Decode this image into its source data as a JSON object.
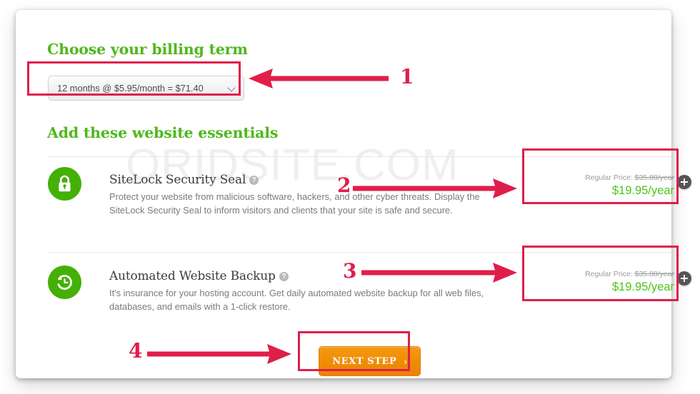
{
  "watermark": "ORIDSITE.COM",
  "billing": {
    "heading": "Choose your billing term",
    "selected_option": "12 months @ $5.95/month = $71.40",
    "chevron_icon": "chevron-down-icon"
  },
  "essentials": {
    "heading": "Add these website essentials",
    "items": [
      {
        "icon": "padlock-icon",
        "title": "SiteLock Security Seal",
        "help_icon": "question-mark-icon",
        "help_glyph": "?",
        "description": "Protect your website from malicious software, hackers, and other cyber threats. Display the SiteLock Security Seal to inform visitors and clients that your site is safe and secure.",
        "regular_price_label": "Regular Price:",
        "regular_price": "$35.88/year",
        "sale_price": "$19.95/year",
        "add_icon": "plus-icon"
      },
      {
        "icon": "clock-restore-icon",
        "title": "Automated Website Backup",
        "help_icon": "question-mark-icon",
        "help_glyph": "?",
        "description": "It's insurance for your hosting account. Get daily automated website backup for all web files, databases, and emails with a 1-click restore.",
        "regular_price_label": "Regular Price:",
        "regular_price": "$35.88/year",
        "sale_price": "$19.95/year",
        "add_icon": "plus-icon"
      }
    ]
  },
  "next_button": {
    "label": "NEXT STEP",
    "caret": "›"
  },
  "annotations": {
    "numbers": [
      "1",
      "2",
      "3",
      "4"
    ]
  },
  "colors": {
    "accent_green": "#4fb81c",
    "price_green": "#4fc319",
    "icon_green": "#44b006",
    "annotation_red": "#e01e4a",
    "button_orange": "#f08c06",
    "body_text": "#7a7a7a",
    "title_text": "#3b3b3b"
  }
}
